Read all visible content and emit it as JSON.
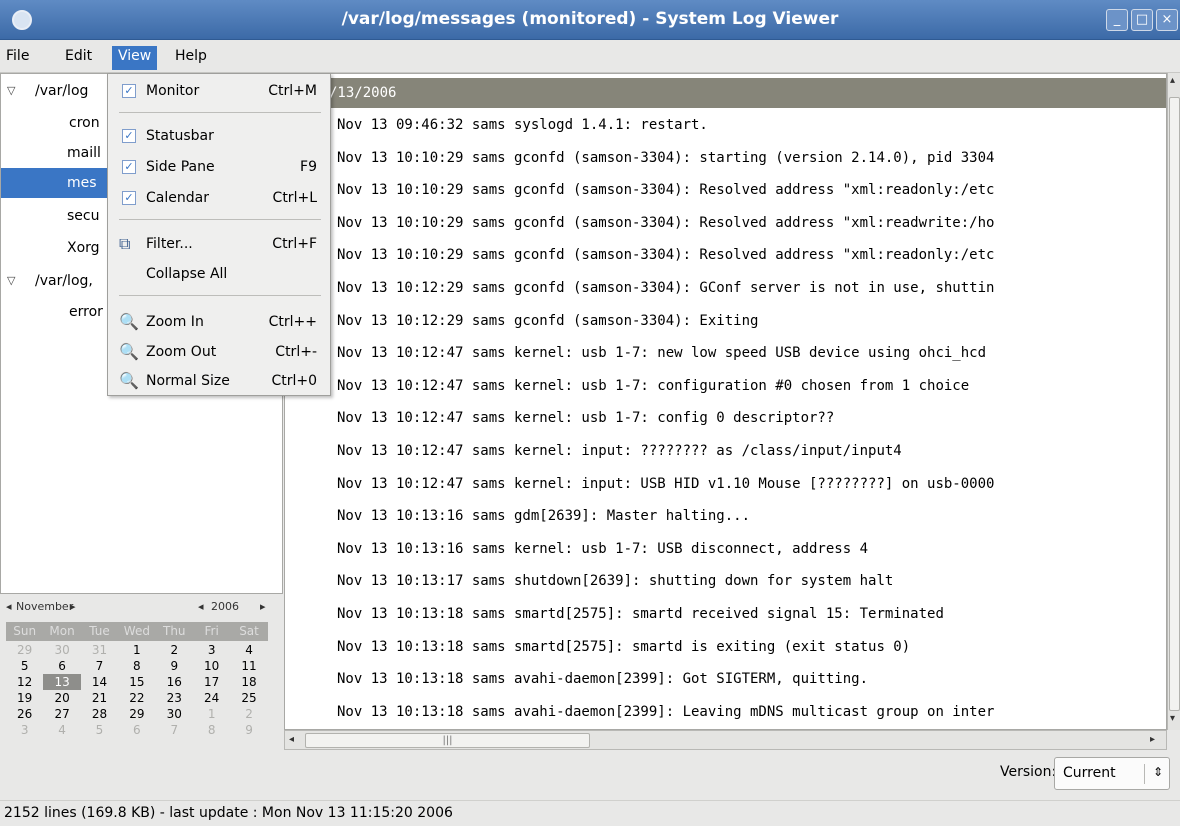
{
  "window": {
    "title": "/var/log/messages (monitored) - System Log Viewer"
  },
  "menubar": {
    "file": "File",
    "edit": "Edit",
    "view": "View",
    "help": "Help"
  },
  "view_menu": {
    "monitor": {
      "label": "Monitor",
      "accel": "Ctrl+M",
      "checked": true
    },
    "statusbar": {
      "label": "Statusbar",
      "accel": "",
      "checked": true
    },
    "side_pane": {
      "label": "Side Pane",
      "accel": "F9",
      "checked": true
    },
    "calendar": {
      "label": "Calendar",
      "accel": "Ctrl+L",
      "checked": true
    },
    "filter": {
      "label": "Filter...",
      "accel": "Ctrl+F"
    },
    "collapse_all": {
      "label": "Collapse All"
    },
    "zoom_in": {
      "label": "Zoom In",
      "accel": "Ctrl++"
    },
    "zoom_out": {
      "label": "Zoom Out",
      "accel": "Ctrl+-"
    },
    "normal_size": {
      "label": "Normal Size",
      "accel": "Ctrl+0"
    }
  },
  "sidebar": {
    "groups": [
      {
        "label": "/var/log",
        "items": [
          "cron",
          "maill",
          "mes",
          "secu",
          "Xorg"
        ]
      },
      {
        "label": "/var/log,",
        "items": [
          "error"
        ]
      }
    ],
    "selected": "mes"
  },
  "calendar": {
    "month": "November",
    "year": "2006",
    "weekdays": [
      "Sun",
      "Mon",
      "Tue",
      "Wed",
      "Thu",
      "Fri",
      "Sat"
    ],
    "weeks": [
      [
        "29",
        "30",
        "31",
        "1",
        "2",
        "3",
        "4"
      ],
      [
        "5",
        "6",
        "7",
        "8",
        "9",
        "10",
        "11"
      ],
      [
        "12",
        "13",
        "14",
        "15",
        "16",
        "17",
        "18"
      ],
      [
        "19",
        "20",
        "21",
        "22",
        "23",
        "24",
        "25"
      ],
      [
        "26",
        "27",
        "28",
        "29",
        "30",
        "1",
        "2"
      ],
      [
        "3",
        "4",
        "5",
        "6",
        "7",
        "8",
        "9"
      ]
    ],
    "selected_day": "13"
  },
  "log": {
    "header": "/13/2006",
    "lines": [
      "Nov 13 09:46:32 sams syslogd 1.4.1: restart.",
      "Nov 13 10:10:29 sams gconfd (samson-3304): starting (version 2.14.0), pid 3304",
      "Nov 13 10:10:29 sams gconfd (samson-3304): Resolved address \"xml:readonly:/etc",
      "Nov 13 10:10:29 sams gconfd (samson-3304): Resolved address \"xml:readwrite:/ho",
      "Nov 13 10:10:29 sams gconfd (samson-3304): Resolved address \"xml:readonly:/etc",
      "Nov 13 10:12:29 sams gconfd (samson-3304): GConf server is not in use, shuttin",
      "Nov 13 10:12:29 sams gconfd (samson-3304): Exiting",
      "Nov 13 10:12:47 sams kernel: usb 1-7: new low speed USB device using ohci_hcd",
      "Nov 13 10:12:47 sams kernel: usb 1-7: configuration #0 chosen from 1 choice",
      "Nov 13 10:12:47 sams kernel: usb 1-7: config 0 descriptor??",
      "Nov 13 10:12:47 sams kernel: input: ???????? as /class/input/input4",
      "Nov 13 10:12:47 sams kernel: input: USB HID v1.10 Mouse [????????] on usb-0000",
      "Nov 13 10:13:16 sams gdm[2639]: Master halting...",
      "Nov 13 10:13:16 sams kernel: usb 1-7: USB disconnect, address 4",
      "Nov 13 10:13:17 sams shutdown[2639]: shutting down for system halt",
      "Nov 13 10:13:18 sams smartd[2575]: smartd received signal 15: Terminated",
      "Nov 13 10:13:18 sams smartd[2575]: smartd is exiting (exit status 0)",
      "Nov 13 10:13:18 sams avahi-daemon[2399]: Got SIGTERM, quitting.",
      "Nov 13 10:13:18 sams avahi-daemon[2399]: Leaving mDNS multicast group on inter"
    ]
  },
  "version": {
    "label": "Version:",
    "value": "Current"
  },
  "statusbar": {
    "text": "2152 lines (169.8 KB) - last update : Mon Nov 13 11:15:20 2006"
  },
  "colors": {
    "titlebar": "#4a78b7",
    "selection": "#3a76c5",
    "log_header": "#868579"
  },
  "icons": {
    "window": "app-icon",
    "filter": "filter-icon",
    "zoom": "magnifier-icon"
  }
}
